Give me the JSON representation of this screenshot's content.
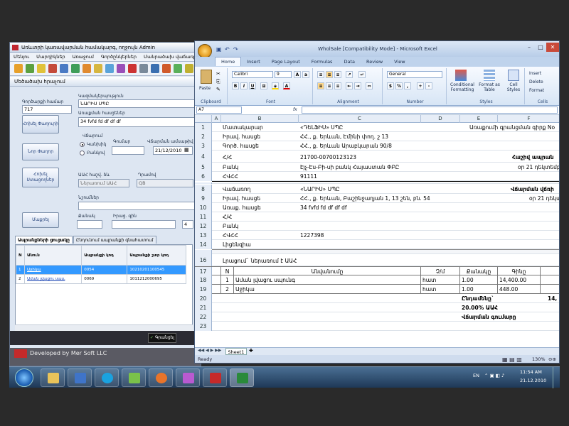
{
  "app": {
    "title": "Առևտրի կառավարման համակարգ, ողջույն Admin",
    "menu": [
      "Մենյու",
      "Մարդիկներ",
      "Առաջում",
      "Գործընկերներ",
      "Մանրածախ վաճառք"
    ],
    "form_title": "Մեծածախ հրաչում",
    "doc_no_label": "Գործարքի համար",
    "doc_no": "717",
    "customer_label": "Կազմակերպություն",
    "customer": "ՆԱՐԻՍ ՍՊԸ",
    "address_label": "Առաքման հասցեներ",
    "address": "34 fvfd fd df df df",
    "btn_change_contact": "Հոխել Փաղուրի",
    "btn_new_contact": "Նոր Փաղոր",
    "btn_change_customer": "Հոխել Ստացողներ",
    "payment_label": "Վճարում",
    "cash_label": "Կանխիկ",
    "noncash_label": "Բանկով",
    "amount_label": "Գումար",
    "date_label": "Վճարման ամսաթիվ",
    "date": "21/12/2010",
    "vat_label": "ԱԱՀ հաշվ. ձև",
    "vat_type": "Ներառում ԱԱՀ",
    "currency_label": "Դրամով",
    "currency": "QB",
    "note_label": "Նշումներ",
    "clear_button": "Մաքրել",
    "qty_label": "Քանակ",
    "price_label": "Իրաց. գին",
    "qty_value": "4",
    "tab_products": "Ապրանքների ցուցակը",
    "tab_other": "Ընդունում ապրանքի գնահատում",
    "grid_headers": [
      "N",
      "Անուն",
      "Ապրանքի կոդ",
      "Ապրանքի շտր կոդ"
    ],
    "grid_rows": [
      {
        "n": "1",
        "name": "Աջիկա",
        "code": "0054",
        "barcode": "10210201100545"
      },
      {
        "n": "2",
        "name": "Աման լվացու սաււ",
        "code": "0069",
        "barcode": "1011212000695"
      }
    ],
    "ok_button": "Գրանցել",
    "footer": "Developed by Mer Soft LLC"
  },
  "excel": {
    "title": "WholSale  [Compatibility Mode] - Microsoft Excel",
    "tabs": [
      "Home",
      "Insert",
      "Page Layout",
      "Formulas",
      "Data",
      "Review",
      "View"
    ],
    "font": "Calibri",
    "font_size": "9",
    "number_format": "General",
    "groups": {
      "clipboard": "Clipboard",
      "font": "Font",
      "alignment": "Alignment",
      "number": "Number",
      "styles": "Styles",
      "cells": "Cells"
    },
    "paste": "Paste",
    "cond_format": "Conditional Formatting",
    "format_table": "Format as Table",
    "cell_styles": "Cell Styles",
    "insert": "Insert",
    "delete": "Delete",
    "format": "Format",
    "name_box": "A7",
    "fx": "fx",
    "columns": [
      "A",
      "B",
      "C",
      "D",
      "E",
      "F"
    ],
    "rows": [
      {
        "n": "1",
        "b": "Մատակարար",
        "c": "«ԴԵԼՖԻՍ» ՍՊԸ",
        "e": "Առաքումի գրանցման գիրք No"
      },
      {
        "n": "2",
        "b": "Իրավ. հասցե",
        "c": "ՀՀ., ք. Երևան, Էմինի փող. շ 13"
      },
      {
        "n": "3",
        "b": "Գործ. հասցե",
        "c": "ՀՀ., ք. Երևան Արաբկարան 90/8"
      },
      {
        "n": "4",
        "b": "Հ/Հ",
        "c": "21700-00700123123",
        "f": "Հաշիվ ապրան"
      },
      {
        "n": "5",
        "b": "Բանկ",
        "c": "Էյչ-Էս-Բի-սի բանկ Հայաստան ՓԲԸ",
        "f": "օր 21 դեկտեմբ"
      },
      {
        "n": "6",
        "b": "ՀՎՀՀ",
        "c": "91111"
      },
      {
        "n": "8",
        "b": "Վաճառող",
        "c": "«ՆԱՐԻՍ» ՍՊԸ",
        "f": "Վճարման վճռի"
      },
      {
        "n": "9",
        "b": "Իրավ. հասցե",
        "c": "ՀՀ., ք. Երևան, Բաշինջաղյան 1, 13 շեն, բն. 54",
        "f": "օր 21 դեկտեմ"
      },
      {
        "n": "10",
        "b": "Առաք. հասցե",
        "c": "34 fvfd fd df df df"
      },
      {
        "n": "11",
        "b": "Հ/Հ",
        "c": ""
      },
      {
        "n": "12",
        "b": "Բանկ",
        "c": ""
      },
      {
        "n": "13",
        "b": "ՀՎՀՀ",
        "c": "1227398"
      },
      {
        "n": "14",
        "b": "Լիցենզիա",
        "c": ""
      },
      {
        "n": "16",
        "b": "Լրացում` ներառում է ԱԱՀ",
        "c": ""
      }
    ],
    "table_header": {
      "n": "17",
      "b": "N",
      "c": "Անվանումը",
      "d": "Չ/մ",
      "e": "Քանակը",
      "f": "Գինը"
    },
    "items": [
      {
        "n": "18",
        "b": "1",
        "c": "Աման լվացու սպունգ",
        "d": "հատ",
        "e": "1.00",
        "f": "14,400.00"
      },
      {
        "n": "19",
        "b": "2",
        "c": "Աջիկա",
        "d": "հատ",
        "e": "1.00",
        "f": "448.00"
      }
    ],
    "total_rows": [
      {
        "n": "20",
        "e": "Ընդամենը`",
        "f": "14,"
      },
      {
        "n": "21",
        "e": "20.00% ԱԱՀ",
        "f": ""
      },
      {
        "n": "22",
        "e": "Վճարման գումարը",
        "f": ""
      },
      {
        "n": "23",
        "e": "",
        "f": ""
      }
    ],
    "sheet_tab": "Sheet1",
    "status": "Ready",
    "zoom": "130%"
  },
  "taskbar": {
    "lang": "EN",
    "time": "11:54 AM",
    "date": "21.12.2010"
  }
}
